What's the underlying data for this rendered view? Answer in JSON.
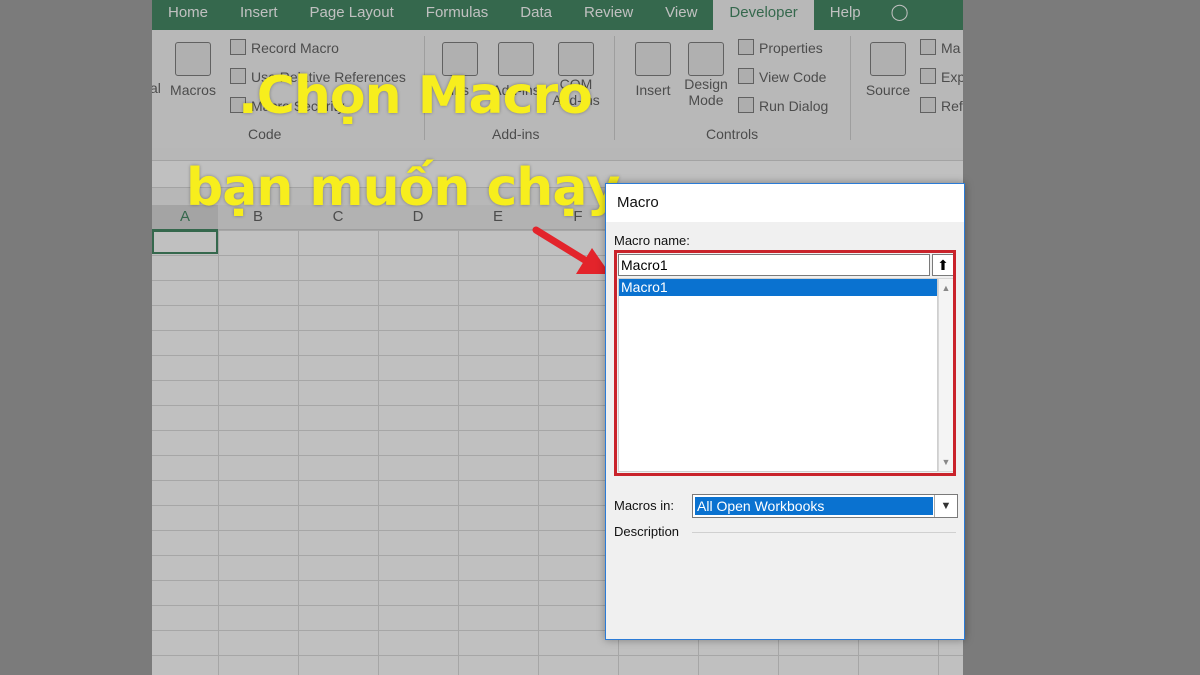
{
  "ribbon_tabs": [
    "Home",
    "Insert",
    "Page Layout",
    "Formulas",
    "Data",
    "Review",
    "View",
    "Developer",
    "Help"
  ],
  "active_tab": "Developer",
  "ribbon": {
    "code_group": {
      "label": "Code",
      "left_partial": "al",
      "macros_button": "Macros",
      "record_macro": "Record Macro",
      "use_relative": "Use Relative References",
      "macro_security": "Macro Security"
    },
    "addins_group": {
      "label": "Add-ins",
      "addins_partial": "ins",
      "excel_addins": "Add-ins",
      "com": "COM",
      "com_addins": "Add-ins"
    },
    "controls_group": {
      "label": "Controls",
      "insert": "Insert",
      "design": "Design",
      "mode": "Mode",
      "properties": "Properties",
      "view_code": "View Code",
      "run_dialog": "Run Dialog"
    },
    "xml_group": {
      "source": "Source",
      "map_partial": "Ma",
      "exp_partial": "Exp",
      "ref_partial": "Ref"
    }
  },
  "columns": [
    "A",
    "B",
    "C",
    "D",
    "E",
    "F"
  ],
  "callout": {
    "line1": ".Chọn Macro",
    "line2": "bạn muốn chạy"
  },
  "dialog": {
    "title": "Macro",
    "macro_name_label": "Macro name:",
    "macro_name_value": "Macro1",
    "list_items": [
      "Macro1"
    ],
    "selected_item": "Macro1",
    "macros_in_label": "Macros in:",
    "macros_in_value": "All Open Workbooks",
    "description_label": "Description"
  },
  "colors": {
    "excel_green": "#1f7246",
    "callout_yellow": "#f7ee1d",
    "highlight_red": "#c9232b",
    "selection_blue": "#0a72d0"
  }
}
